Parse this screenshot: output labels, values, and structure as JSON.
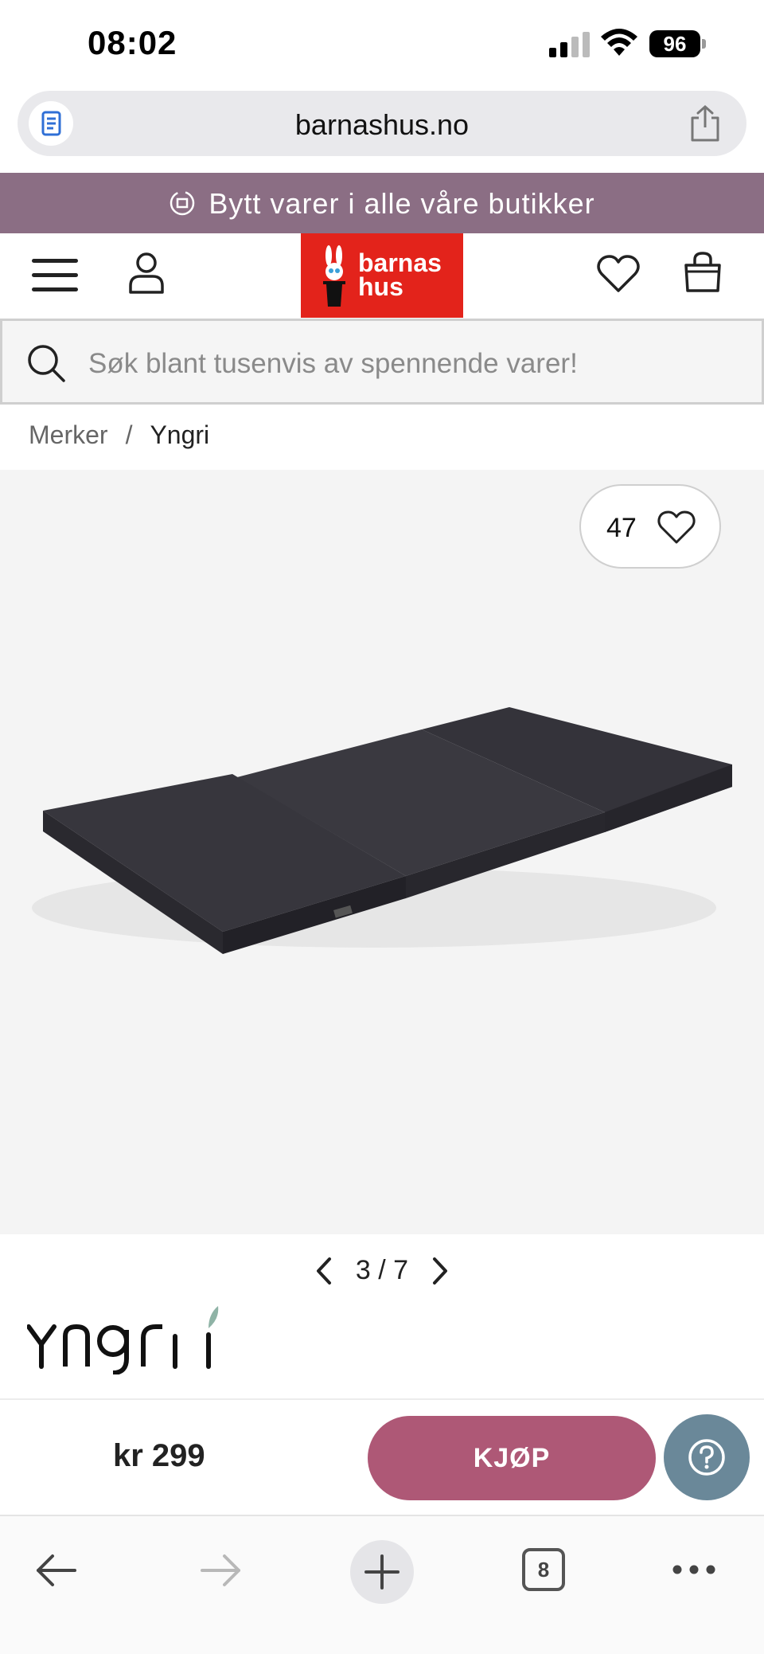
{
  "status_bar": {
    "time": "08:02",
    "battery": "96"
  },
  "browser": {
    "url": "barnashus.no",
    "tab_count": "8"
  },
  "promo": {
    "text": "Bytt varer i alle våre butikker"
  },
  "header": {
    "logo_line1": "barnas",
    "logo_line2": "hus"
  },
  "search": {
    "placeholder": "Søk blant tusenvis av spennende varer!"
  },
  "breadcrumb": {
    "items": [
      "Merker",
      "Yngri"
    ],
    "separator": "/"
  },
  "product": {
    "favorite_count": "47",
    "image_index": "3",
    "image_total": "7",
    "pager_text": "3 / 7",
    "brand": "Yngri",
    "price": "kr 299",
    "buy_label": "KJØP"
  },
  "colors": {
    "promo_bg": "#8b6e84",
    "logo_red": "#e3231b",
    "buy_button": "#ae5876",
    "help_button": "#6a8899"
  },
  "icons": [
    "page-icon",
    "share-icon",
    "menu-icon",
    "user-icon",
    "heart-icon",
    "bag-icon",
    "search-icon",
    "chevron-left-icon",
    "chevron-right-icon",
    "help-icon",
    "back-arrow-icon",
    "forward-arrow-icon",
    "plus-icon",
    "more-icon"
  ]
}
